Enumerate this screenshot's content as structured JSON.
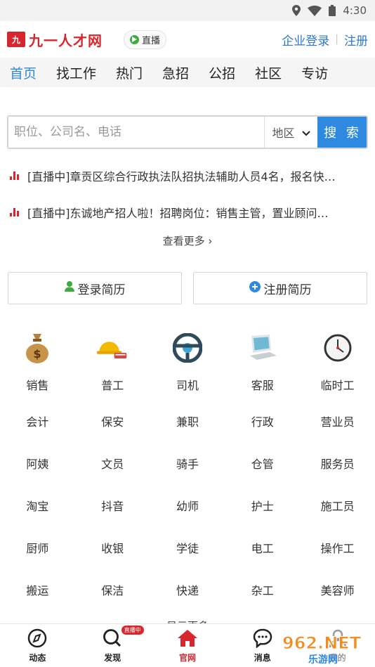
{
  "status_bar": {
    "time": "4:30"
  },
  "header": {
    "logo_mark": "九",
    "logo_text": "九一人才网",
    "live_label": "直播",
    "company_login": "企业登录",
    "separator": "|",
    "register": "注册"
  },
  "nav": [
    {
      "label": "首页",
      "active": true
    },
    {
      "label": "找工作"
    },
    {
      "label": "热门"
    },
    {
      "label": "急招"
    },
    {
      "label": "公招"
    },
    {
      "label": "社区"
    },
    {
      "label": "专访"
    }
  ],
  "search": {
    "placeholder": "职位、公司名、电话",
    "region_label": "地区",
    "button_label": "搜 索"
  },
  "feed": [
    "[直播中]章贡区综合行政执法队招执法辅助人员4名，报名快…",
    "[直播中]东诚地产招人啦！招聘岗位：销售主管，置业顾问…"
  ],
  "see_more": "查看更多 ›",
  "resume": {
    "login": "登录简历",
    "register": "注册简历"
  },
  "categories_with_icons": [
    {
      "label": "销售",
      "icon": "money-bag-icon"
    },
    {
      "label": "普工",
      "icon": "hardhat-icon"
    },
    {
      "label": "司机",
      "icon": "steering-wheel-icon"
    },
    {
      "label": "客服",
      "icon": "computer-icon"
    },
    {
      "label": "临时工",
      "icon": "clock-icon"
    }
  ],
  "categories": [
    "会计",
    "保安",
    "兼职",
    "行政",
    "营业员",
    "阿姨",
    "文员",
    "骑手",
    "仓管",
    "服务员",
    "淘宝",
    "抖音",
    "幼师",
    "护士",
    "施工员",
    "厨师",
    "收银",
    "学徒",
    "电工",
    "操作工",
    "搬运",
    "保洁",
    "快递",
    "杂工",
    "美容师"
  ],
  "partial_more": "显示更多",
  "tabbar": [
    {
      "label": "动态",
      "icon": "compass-icon"
    },
    {
      "label": "发现",
      "icon": "search-icon",
      "badge": "直播中"
    },
    {
      "label": "官网",
      "icon": "home-icon",
      "active": true
    },
    {
      "label": "消息",
      "icon": "chat-icon"
    },
    {
      "label": "我的",
      "icon": "user-icon"
    }
  ],
  "watermark": {
    "text": "962.NET",
    "subtext": "乐游网"
  },
  "colors": {
    "brand_red": "#d8262e",
    "accent_blue": "#2e8ae0",
    "link_blue": "#2f79c9"
  }
}
